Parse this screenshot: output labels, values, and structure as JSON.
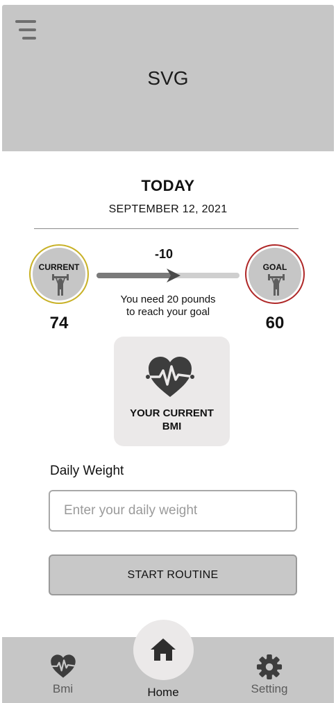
{
  "header": {
    "title": "SVG",
    "menu_icon": "hamburger-menu-icon"
  },
  "today": {
    "title": "TODAY",
    "date": "SEPTEMBER 12, 2021"
  },
  "progress": {
    "current_label": "CURRENT",
    "current_value": "74",
    "goal_label": "GOAL",
    "goal_value": "60",
    "difference": "-10",
    "fill_fraction": 0.55,
    "message_line1": "You need 20 pounds",
    "message_line2": "to reach your goal",
    "badge_icon": "weightlifter-icon",
    "current_ring_color": "#c9b227",
    "goal_ring_color": "#b02828"
  },
  "bmi_card": {
    "line1": "YOUR CURRENT",
    "line2": "BMI",
    "icon": "heart-pulse-icon"
  },
  "daily_weight": {
    "label": "Daily Weight",
    "value": "",
    "placeholder": "Enter your daily weight"
  },
  "start_button": {
    "label": "START ROUTINE"
  },
  "bottom_nav": {
    "items": [
      {
        "label": "Bmi",
        "icon": "heart-pulse-icon"
      },
      {
        "label": "Home",
        "icon": "home-icon"
      },
      {
        "label": "Setting",
        "icon": "gear-icon"
      }
    ]
  }
}
